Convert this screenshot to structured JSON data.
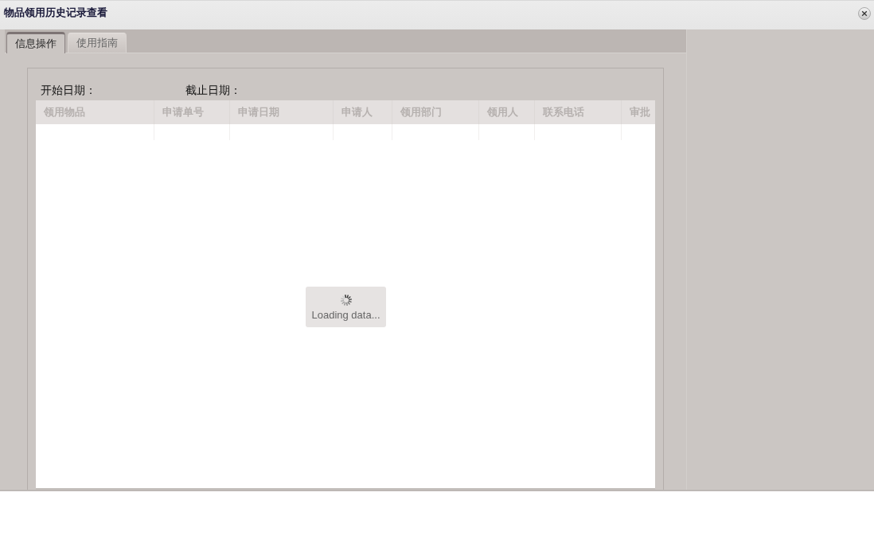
{
  "window": {
    "title": "物品领用历史记录查看"
  },
  "tabs": [
    {
      "label": "信息操作",
      "selected": true
    },
    {
      "label": "使用指南",
      "selected": false
    }
  ],
  "filters": [
    {
      "label": "开始日期："
    },
    {
      "label": "截止日期："
    }
  ],
  "table": {
    "columns": [
      "领用物品",
      "申请单号",
      "申请日期",
      "申请人",
      "领用部门",
      "领用人",
      "联系电话",
      "审批"
    ]
  },
  "loading": {
    "text": "Loading data..."
  }
}
